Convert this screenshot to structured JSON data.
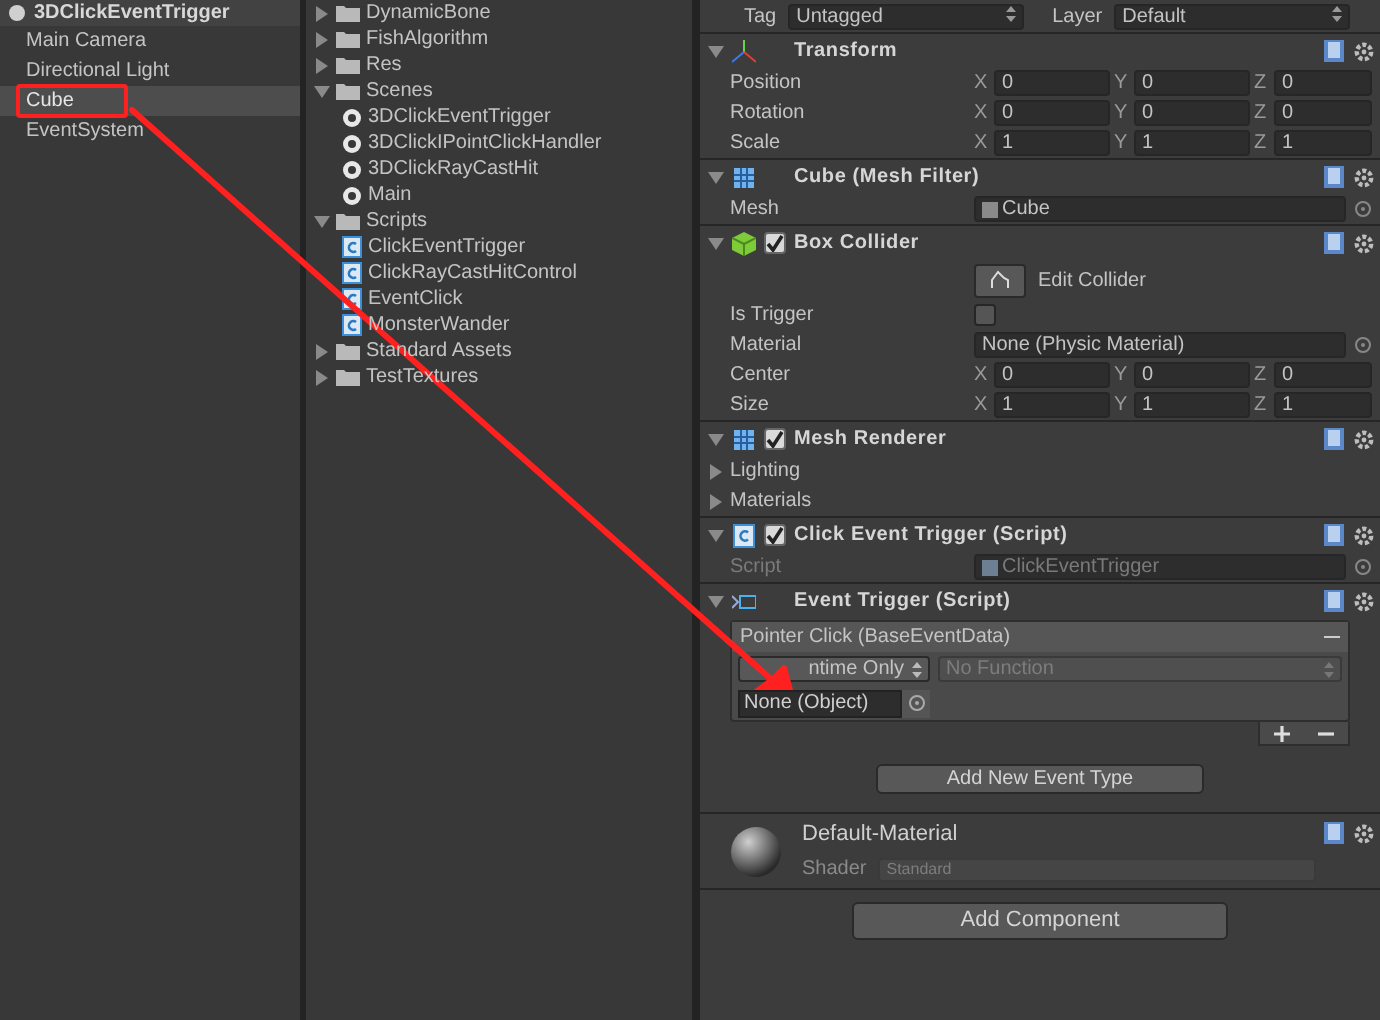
{
  "hierarchy": {
    "scene_title": "3DClickEventTrigger",
    "items": [
      {
        "label": "Main Camera",
        "selected": false
      },
      {
        "label": "Directional Light",
        "selected": false
      },
      {
        "label": "Cube",
        "selected": true
      },
      {
        "label": "EventSystem",
        "selected": false
      }
    ]
  },
  "project": {
    "items": [
      {
        "kind": "folder",
        "label": "DynamicBone",
        "expanded": false
      },
      {
        "kind": "folder",
        "label": "FishAlgorithm",
        "expanded": false
      },
      {
        "kind": "folder",
        "label": "Res",
        "expanded": false
      },
      {
        "kind": "folder",
        "label": "Scenes",
        "expanded": true,
        "children": [
          {
            "kind": "scene",
            "label": "3DClickEventTrigger"
          },
          {
            "kind": "scene",
            "label": "3DClickIPointClickHandler"
          },
          {
            "kind": "scene",
            "label": "3DClickRayCastHit"
          },
          {
            "kind": "scene",
            "label": "Main"
          }
        ]
      },
      {
        "kind": "folder",
        "label": "Scripts",
        "expanded": true,
        "children": [
          {
            "kind": "script",
            "label": "ClickEventTrigger"
          },
          {
            "kind": "script",
            "label": "ClickRayCastHitControl"
          },
          {
            "kind": "script",
            "label": "EventClick"
          },
          {
            "kind": "script",
            "label": "MonsterWander"
          }
        ]
      },
      {
        "kind": "folder",
        "label": "Standard Assets",
        "expanded": false
      },
      {
        "kind": "folder",
        "label": "TestTextures",
        "expanded": false
      }
    ]
  },
  "inspector": {
    "tag_label": "Tag",
    "tag": "Untagged",
    "layer_label": "Layer",
    "layer": "Default",
    "components": [
      {
        "kind": "transform",
        "title": "Transform",
        "rows": [
          {
            "kind": "vector3",
            "label": "Position",
            "fields": [
              {
                "axis": "X",
                "value": "0"
              },
              {
                "axis": "Y",
                "value": "0"
              },
              {
                "axis": "Z",
                "value": "0"
              }
            ]
          },
          {
            "kind": "vector3",
            "label": "Rotation",
            "fields": [
              {
                "axis": "X",
                "value": "0"
              },
              {
                "axis": "Y",
                "value": "0"
              },
              {
                "axis": "Z",
                "value": "0"
              }
            ]
          },
          {
            "kind": "vector3",
            "label": "Scale",
            "fields": [
              {
                "axis": "X",
                "value": "1"
              },
              {
                "axis": "Y",
                "value": "1"
              },
              {
                "axis": "Z",
                "value": "1"
              }
            ]
          }
        ]
      },
      {
        "kind": "mesh_filter",
        "title": "Cube (Mesh Filter)",
        "rows": [
          {
            "kind": "object",
            "label": "Mesh",
            "value": "Cube",
            "disabled": false
          }
        ]
      },
      {
        "kind": "collider",
        "title": "Box Collider",
        "enabled": true,
        "rows": [
          {
            "kind": "edit_button",
            "label": "Edit Collider"
          },
          {
            "kind": "checkbox",
            "label": "Is Trigger",
            "checked": false
          },
          {
            "kind": "object",
            "label": "Material",
            "value": "None (Physic Material)",
            "disabled": false
          },
          {
            "kind": "vector3",
            "label": "Center",
            "fields": [
              {
                "axis": "X",
                "value": "0"
              },
              {
                "axis": "Y",
                "value": "0"
              },
              {
                "axis": "Z",
                "value": "0"
              }
            ]
          },
          {
            "kind": "vector3",
            "label": "Size",
            "fields": [
              {
                "axis": "X",
                "value": "1"
              },
              {
                "axis": "Y",
                "value": "1"
              },
              {
                "axis": "Z",
                "value": "1"
              }
            ]
          }
        ]
      },
      {
        "kind": "renderer",
        "title": "Mesh Renderer",
        "enabled": true,
        "rows": [
          {
            "kind": "foldout",
            "label": "Lighting",
            "expanded": false
          },
          {
            "kind": "foldout",
            "label": "Materials",
            "expanded": false
          }
        ]
      },
      {
        "kind": "script",
        "title": "Click Event Trigger (Script)",
        "enabled": true,
        "rows": [
          {
            "kind": "object",
            "label": "Script",
            "value": "ClickEventTrigger",
            "disabled": true
          }
        ]
      },
      {
        "kind": "event_trigger",
        "title": "Event Trigger (Script)",
        "event": "Pointer Click (BaseEventData)",
        "runtime": "ntime Only",
        "function": "No Function",
        "target": "None (Object)",
        "add_button": "Add New Event Type"
      }
    ],
    "material": {
      "name": "Default-Material",
      "shader_label": "Shader",
      "shader": "Standard"
    },
    "add_component": "Add Component"
  }
}
